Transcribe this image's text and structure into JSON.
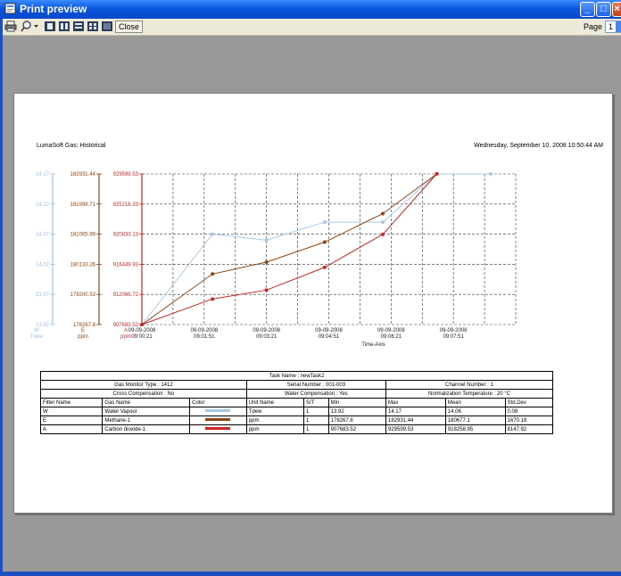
{
  "window": {
    "title": "Print preview"
  },
  "toolbar": {
    "close_label": "Close",
    "page_label": "Page",
    "page_value": "1"
  },
  "report": {
    "title": "LumaSoft Gas: Historical",
    "date": "Wednesday, September 10, 2008 10:50:44 AM"
  },
  "colors": {
    "water": "#a8c8ea",
    "methane": "#8b4513",
    "co2": "#c62828"
  },
  "chart_data": {
    "type": "line",
    "xlabel": "Time-Axis",
    "x_ticks": [
      "09-09-2008\n09:00:21",
      "09-09-2008\n09:01:51",
      "09-09-2008\n09:03:21",
      "09-09-2008\n09:04:51",
      "09-09-2008\n09:06:21",
      "09-09-2008\n09:07:51"
    ],
    "axes": [
      {
        "name": "W",
        "unit": "Tdew",
        "ticks": [
          "14.17",
          "14.12",
          "14.07",
          "14.02",
          "13.97",
          "13.92"
        ]
      },
      {
        "name": "E",
        "unit": "ppm",
        "ticks": [
          "182931.44",
          "181998.71",
          "181065.99",
          "180133.26",
          "179200.53",
          "178267.8"
        ]
      },
      {
        "name": "A",
        "unit": "ppm",
        "ticks": [
          "929599.53",
          "925216.33",
          "920833.13",
          "916449.93",
          "912066.72",
          "907683.52"
        ]
      }
    ],
    "series": [
      {
        "name": "W",
        "x_min": [
          0,
          1.7,
          3.0,
          4.4,
          5.8,
          7.1,
          8.4
        ],
        "values": [
          13.92,
          14.07,
          14.06,
          14.09,
          14.09,
          14.17,
          14.17
        ]
      },
      {
        "name": "E",
        "x_min": [
          0,
          1.7,
          3.0,
          4.4,
          5.8,
          7.1
        ],
        "values": [
          178267.8,
          179833,
          180200,
          180820,
          181700,
          182931.44
        ]
      },
      {
        "name": "A",
        "x_min": [
          0,
          1.7,
          3.0,
          4.4,
          5.8,
          7.1
        ],
        "values": [
          907683.52,
          911400,
          912700,
          916000,
          920800,
          929599.53
        ]
      }
    ]
  },
  "info": {
    "task_name": "Task Name  : newTask2",
    "monitor_type": "Gas Monitor Type  : 1412",
    "serial": "Serial Number  : 001-003",
    "channel": "Channel Number  : 1",
    "cross": "Cross Compensation  : No",
    "water_comp": "Water Compensation  : Yes",
    "norm_temp": "Normalization Temperature  : 20 °C",
    "headers": [
      "Filter Name",
      "Gas Name",
      "Color",
      "Unit Name",
      "S/T",
      "Min",
      "Max",
      "Mean",
      "Std.Dev"
    ],
    "rows": [
      [
        "W",
        "Water Vapour",
        "",
        "Tdew",
        "1",
        "13.92",
        "14.17",
        "14.06",
        "0.08"
      ],
      [
        "E",
        "Methane-1",
        "",
        "ppm",
        "1",
        "178267.8",
        "182931.44",
        "180677.1",
        "1670.18"
      ],
      [
        "A",
        "Carbon dioxide-1",
        "",
        "ppm",
        "1",
        "907683.52",
        "929599.53",
        "918258.95",
        "8147.92"
      ]
    ]
  }
}
